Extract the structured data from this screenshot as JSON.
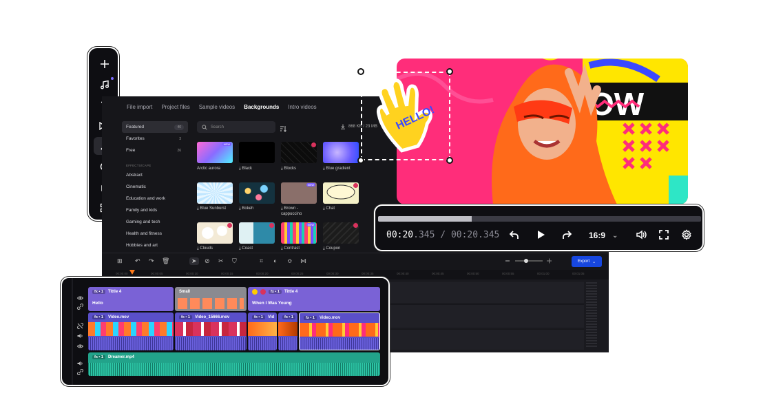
{
  "toolbar": {
    "items": [
      {
        "name": "add-icon",
        "glyph": "+"
      },
      {
        "name": "music-icon",
        "glyph": "♫"
      },
      {
        "name": "text-icon",
        "glyph": "T"
      },
      {
        "name": "transitions-icon",
        "glyph": "⋈"
      },
      {
        "name": "effects-icon",
        "glyph": "✦"
      },
      {
        "name": "stickers-icon",
        "glyph": "◔"
      },
      {
        "name": "elements-icon",
        "glyph": "⌂"
      },
      {
        "name": "more-icon",
        "glyph": "▦"
      }
    ]
  },
  "media": {
    "tabs": [
      "File import",
      "Project files",
      "Sample videos",
      "Backgrounds",
      "Intro videos"
    ],
    "selected_tab": "Backgrounds",
    "categories": [
      {
        "label": "Featured",
        "count": "40"
      },
      {
        "label": "Favorites",
        "count": "3"
      },
      {
        "label": "Free",
        "count": "26"
      }
    ],
    "section_label": "EFFECTS/CAPE",
    "subcategories": [
      "Abstract",
      "Cinematic",
      "Education and work",
      "Family and kids",
      "Gaming and tech",
      "Health and fitness",
      "Hobbies and art"
    ],
    "search_placeholder": "Search",
    "storage": "868 KB / 23 MB",
    "thumbnails": [
      {
        "label": "Arctic aurora",
        "badge": "NEW",
        "download": false
      },
      {
        "label": "Black",
        "download": true
      },
      {
        "label": "Blocks",
        "download": true,
        "crown": true
      },
      {
        "label": "Blue gradient",
        "download": true
      },
      {
        "label": "Blue Sunburst",
        "download": true
      },
      {
        "label": "Bokeh",
        "download": true
      },
      {
        "label": "Brown - cappuccino",
        "download": true,
        "badge": "NEW"
      },
      {
        "label": "Chat",
        "download": true,
        "crown": true
      },
      {
        "label": "Clouds",
        "download": true,
        "crown": true
      },
      {
        "label": "Coast",
        "download": true,
        "crown": true
      },
      {
        "label": "Contrast",
        "download": true,
        "badge": "NEW"
      },
      {
        "label": "Coupon",
        "download": true,
        "crown": true
      }
    ]
  },
  "editor_toolbar": {
    "export_label": "Export"
  },
  "ruler_ticks": [
    "00:00:00",
    "00:00:05",
    "00:00:10",
    "00:00:15",
    "00:00:20",
    "00:00:25",
    "00:00:30",
    "00:00:35",
    "00:00:40",
    "00:00:45",
    "00:00:50",
    "00:00:55",
    "00:01:00",
    "00:01:05"
  ],
  "player": {
    "current_time_main": "00:20",
    "current_time_ms": ".345",
    "separator": " / ",
    "total_time_main": "00:20",
    "total_time_ms": ".345",
    "progress": 0.29,
    "aspect_ratio": "16:9"
  },
  "sticker": {
    "text": "HELLO!"
  },
  "timeline": {
    "clips": {
      "title1_name": "Tittle 4",
      "title1_text": "Hello",
      "small_name": "Small",
      "title2_name": "Tittle 4",
      "title2_text": "When I Was Young",
      "video1": "Video.mov",
      "video2": "Video_15666.mov",
      "video3": "Vid",
      "video4": "Video.mov",
      "audio": "Dreamer.mp4",
      "fx": "fx • 1"
    }
  },
  "colors": {
    "accent": "#7b5cff",
    "title_clip": "#7a62d6",
    "video_clip": "#5a4fc9",
    "audio_clip": "#22a38a",
    "export": "#1747e0",
    "preview_bg": "#ff2d7a",
    "hoodie": "#ff6a1a"
  }
}
